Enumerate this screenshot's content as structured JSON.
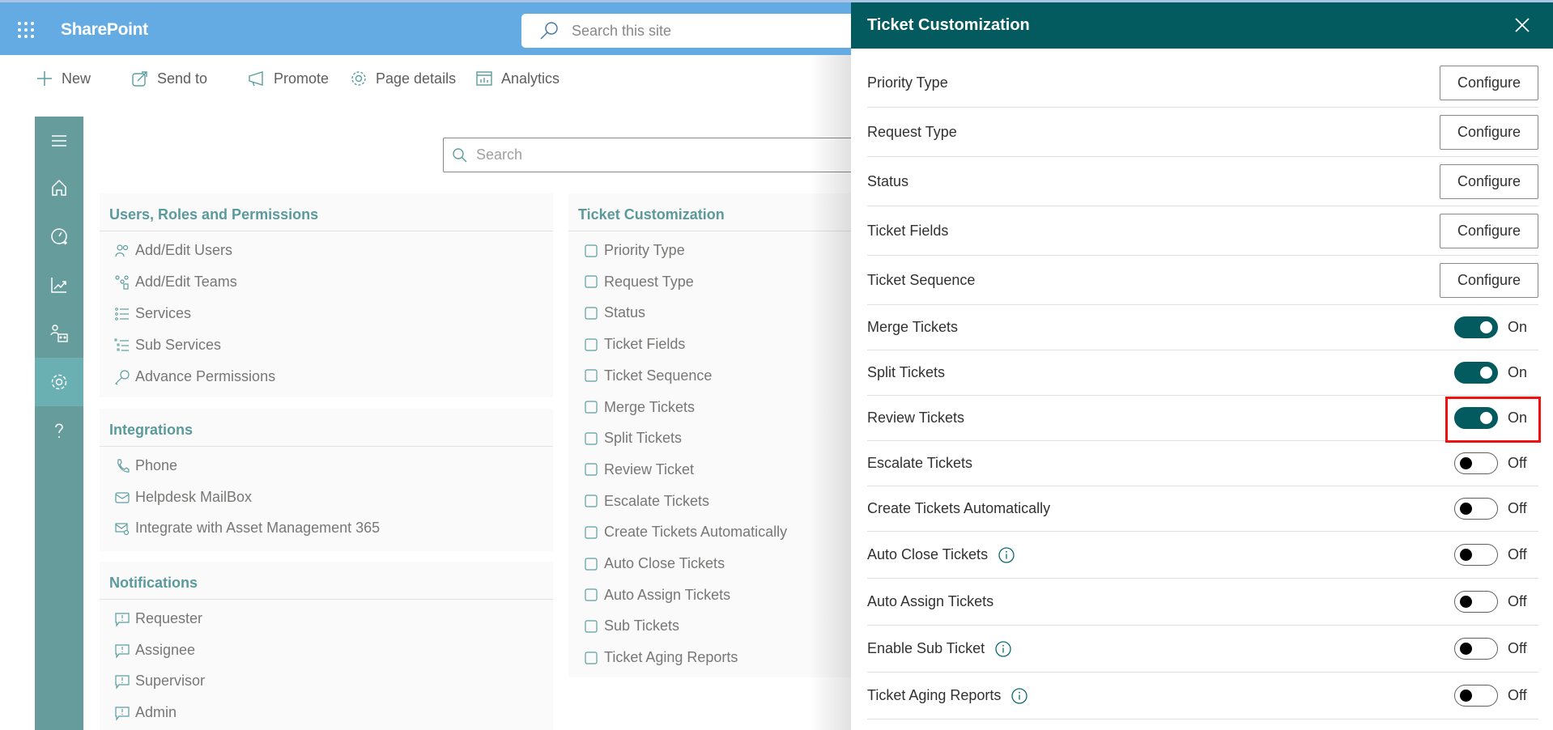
{
  "suite_bar": {
    "app_name": "SharePoint",
    "search_placeholder": "Search this site",
    "icons": {
      "waffle": "app-launcher-icon",
      "search": "search-icon"
    }
  },
  "command_bar": {
    "items": [
      {
        "label": "New",
        "icon": "plus-icon"
      },
      {
        "label": "Send to",
        "icon": "share-icon"
      },
      {
        "label": "Promote",
        "icon": "megaphone-icon"
      },
      {
        "label": "Page details",
        "icon": "gear-icon"
      },
      {
        "label": "Analytics",
        "icon": "analytics-icon"
      }
    ]
  },
  "left_nav": {
    "items": [
      {
        "name": "menu",
        "icon": "hamburger-icon"
      },
      {
        "name": "home",
        "icon": "home-icon"
      },
      {
        "name": "dashboard",
        "icon": "gauge-icon"
      },
      {
        "name": "reports",
        "icon": "chart-line-icon"
      },
      {
        "name": "users",
        "icon": "people-icon"
      },
      {
        "name": "settings",
        "icon": "gear-icon",
        "active": true
      },
      {
        "name": "help",
        "icon": "question-icon"
      }
    ]
  },
  "main_search": {
    "placeholder": "Search"
  },
  "cards": {
    "users_roles": {
      "title": "Users, Roles and Permissions",
      "items": [
        "Add/Edit Users",
        "Add/Edit Teams",
        "Services",
        "Sub Services",
        "Advance Permissions"
      ]
    },
    "integrations": {
      "title": "Integrations",
      "items": [
        "Phone",
        "Helpdesk MailBox",
        "Integrate with Asset Management 365"
      ]
    },
    "notifications": {
      "title": "Notifications",
      "items": [
        "Requester",
        "Assignee",
        "Supervisor",
        "Admin"
      ]
    },
    "ticket_customization": {
      "title": "Ticket Customization",
      "items": [
        "Priority Type",
        "Request Type",
        "Status",
        "Ticket Fields",
        "Ticket Sequence",
        "Merge Tickets",
        "Split Tickets",
        "Review Ticket",
        "Escalate Tickets",
        "Create Tickets Automatically",
        "Auto Close Tickets",
        "Auto Assign Tickets",
        "Sub Tickets",
        "Ticket Aging Reports"
      ]
    }
  },
  "panel": {
    "title": "Ticket Customization",
    "close_icon": "close-icon",
    "configure_label": "Configure",
    "configure_rows": [
      "Priority Type",
      "Request Type",
      "Status",
      "Ticket Fields",
      "Ticket Sequence"
    ],
    "toggle_rows": [
      {
        "label": "Merge Tickets",
        "state": "On",
        "info": false
      },
      {
        "label": "Split Tickets",
        "state": "On",
        "info": false
      },
      {
        "label": "Review Tickets",
        "state": "On",
        "info": false,
        "highlighted": true
      },
      {
        "label": "Escalate Tickets",
        "state": "Off",
        "info": false
      },
      {
        "label": "Create Tickets Automatically",
        "state": "Off",
        "info": false
      },
      {
        "label": "Auto Close Tickets",
        "state": "Off",
        "info": true
      },
      {
        "label": "Auto Assign Tickets",
        "state": "Off",
        "info": false
      },
      {
        "label": "Enable Sub Ticket",
        "state": "Off",
        "info": true
      },
      {
        "label": "Ticket Aging Reports",
        "state": "Off",
        "info": true
      }
    ]
  },
  "colors": {
    "suite_bar": "#65abe3",
    "panel_header": "#035a5f",
    "nav": "#679c9c",
    "nav_active": "#6ab0b3",
    "card_title": "#5a9a9c",
    "highlight": "#f01010"
  }
}
